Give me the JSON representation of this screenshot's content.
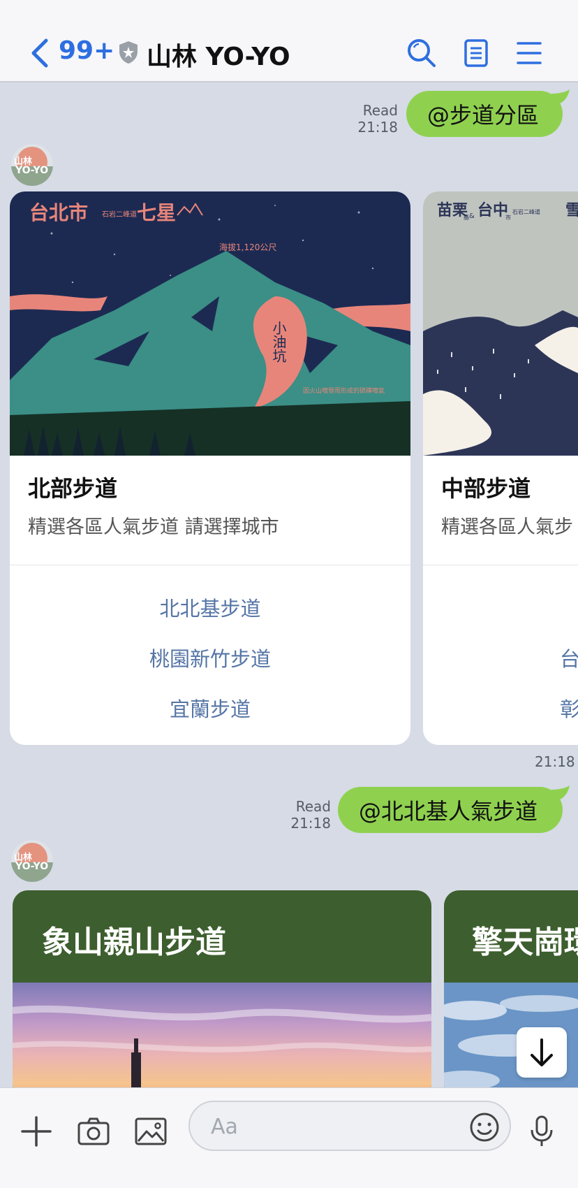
{
  "header": {
    "unread_count": "99+",
    "chat_title": "山林 YO-YO"
  },
  "avatar": {
    "line1": "山林",
    "line2": "YO-YO"
  },
  "messages": {
    "msg1": {
      "text": "@步道分區",
      "read": "Read",
      "time": "21:18"
    },
    "msg2": {
      "text": "@北北基人氣步道",
      "read": "Read",
      "time": "21:18"
    },
    "carousel1_time": "21:18"
  },
  "carousel1": {
    "card1": {
      "title": "北部步道",
      "subtitle": "精選各區人氣步道 請選擇城市",
      "links": [
        "北北基步道",
        "桃園新竹步道",
        "宜蘭步道"
      ],
      "image_text": {
        "headline": "台北市",
        "small": "石岩二峰道",
        "peak": "七星",
        "altitude": "海拔1,120公尺",
        "spot": "小油坑",
        "note": "因火山噴發而形成的硫磺噴氣"
      }
    },
    "card2": {
      "title": "中部步道",
      "subtitle": "精選各區人氣步",
      "links_partial": [
        "台",
        "彰"
      ],
      "image_text": {
        "headline": "苗栗",
        "connector": "&",
        "city": "台中",
        "small1": "縣",
        "small2": "市",
        "small3": "石岩二峰道",
        "peak_partial": "雪"
      }
    }
  },
  "carousel2": {
    "card1_title": "象山親山步道",
    "card2_title_partial": "擎天崗環"
  },
  "input": {
    "placeholder": "Aa"
  },
  "colors": {
    "accent_blue": "#2e6fe0",
    "bubble_green": "#8fd14f",
    "card_green": "#3d5e2e",
    "link_blue": "#5575a6"
  }
}
